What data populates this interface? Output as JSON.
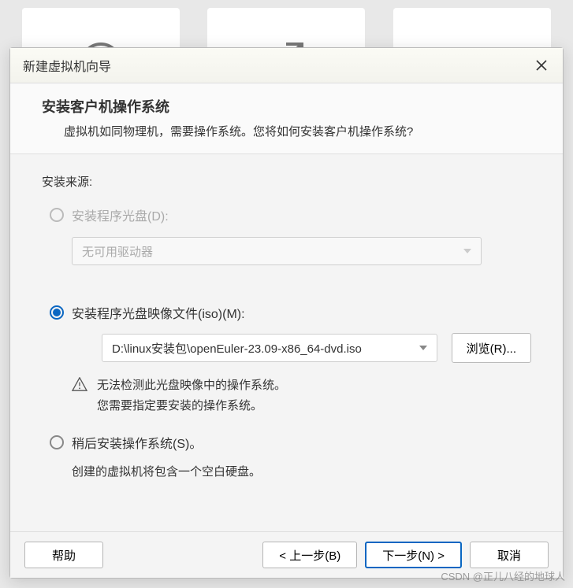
{
  "dialog": {
    "title": "新建虚拟机向导",
    "close_aria": "关闭"
  },
  "header": {
    "title": "安装客户机操作系统",
    "subtitle": "虚拟机如同物理机，需要操作系统。您将如何安装客户机操作系统?"
  },
  "source": {
    "label": "安装来源:",
    "disc": {
      "label": "安装程序光盘(D):",
      "drive_value": "无可用驱动器",
      "enabled": false
    },
    "iso": {
      "label": "安装程序光盘映像文件(iso)(M):",
      "path": "D:\\linux安装包\\openEuler-23.09-x86_64-dvd.iso",
      "browse_label": "浏览(R)...",
      "selected": true,
      "warning_line1": "无法检测此光盘映像中的操作系统。",
      "warning_line2": "您需要指定要安装的操作系统。"
    },
    "later": {
      "label": "稍后安装操作系统(S)。",
      "hint": "创建的虚拟机将包含一个空白硬盘。"
    }
  },
  "footer": {
    "help": "帮助",
    "back": "< 上一步(B)",
    "next": "下一步(N) >",
    "cancel": "取消"
  },
  "watermark": "CSDN @正儿八经的地球人"
}
